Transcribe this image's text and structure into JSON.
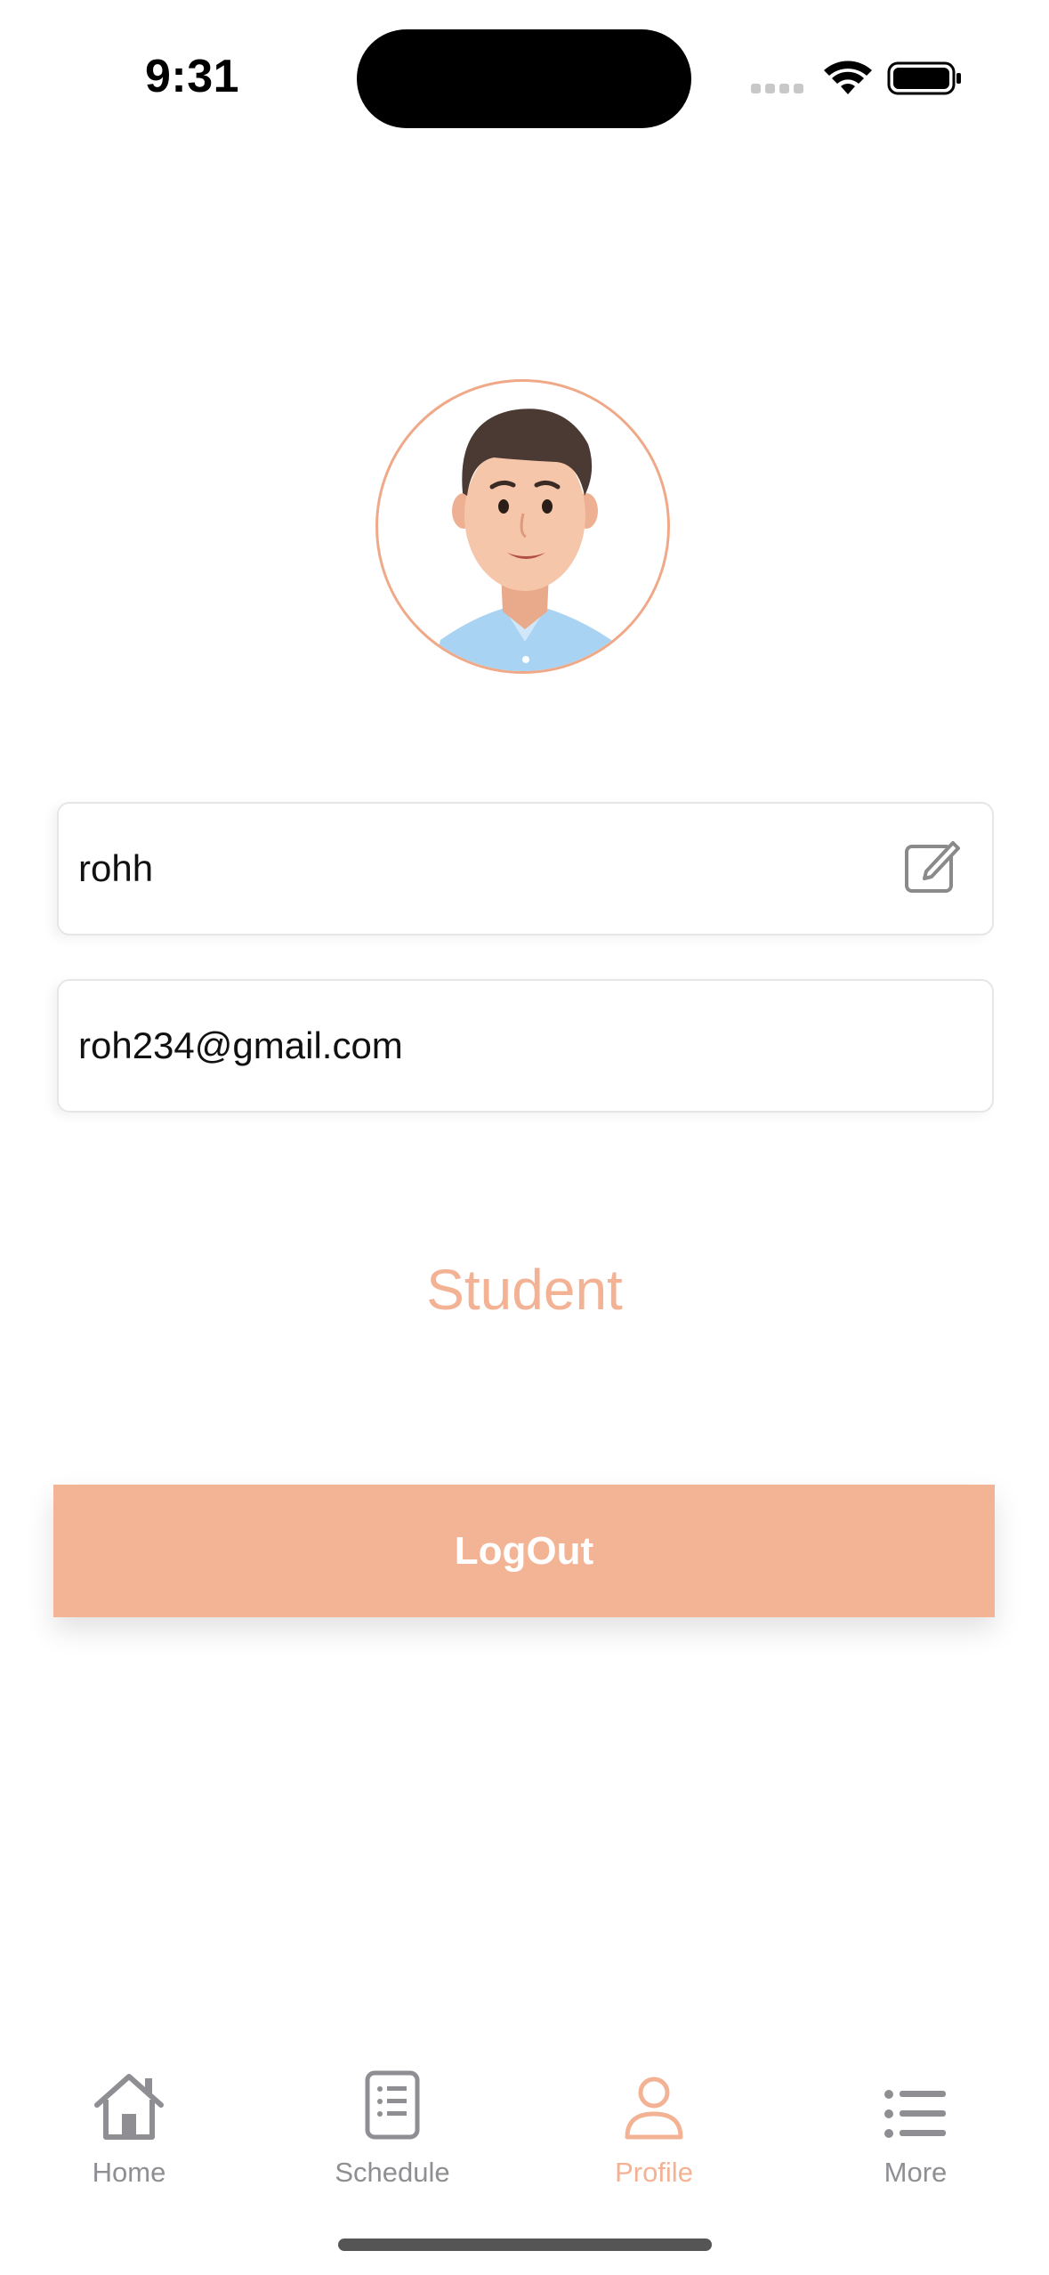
{
  "status_bar": {
    "time": "9:31"
  },
  "profile": {
    "name": "rohh",
    "email": "roh234@gmail.com",
    "role": "Student",
    "logout_label": "LogOut"
  },
  "tabs": [
    {
      "label": "Home",
      "icon": "home-icon",
      "active": false
    },
    {
      "label": "Schedule",
      "icon": "schedule-icon",
      "active": false
    },
    {
      "label": "Profile",
      "icon": "profile-icon",
      "active": true
    },
    {
      "label": "More",
      "icon": "menu-icon",
      "active": false
    }
  ],
  "colors": {
    "accent": "#f3b294",
    "button": "#f3b496",
    "inactive": "#8e8e93"
  }
}
